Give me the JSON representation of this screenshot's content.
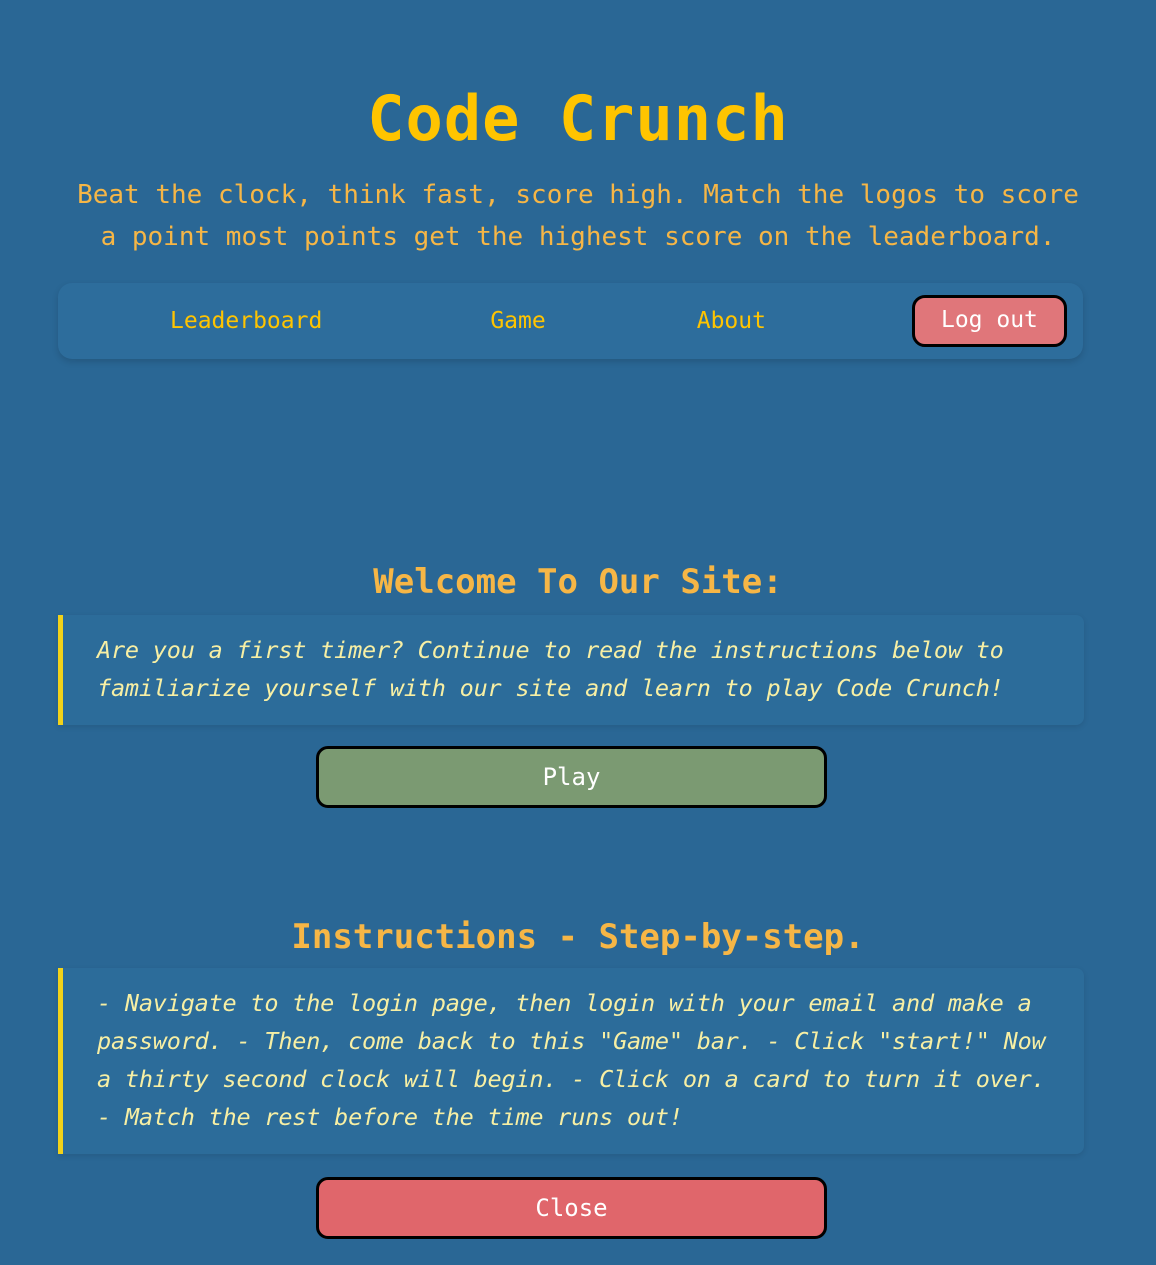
{
  "header": {
    "title": "Code Crunch",
    "tagline": "Beat the clock, think fast, score high. Match the logos to score a point most points get the highest score on the leaderboard."
  },
  "nav": {
    "links": [
      {
        "label": "Leaderboard"
      },
      {
        "label": "Game"
      },
      {
        "label": "About"
      }
    ],
    "logout_label": "Log out"
  },
  "welcome": {
    "heading": "Welcome To Our Site:",
    "quote": "Are you a first timer? Continue to read the instructions below to familiarize yourself with our site and learn to play Code Crunch!",
    "play_label": "Play"
  },
  "instructions": {
    "heading": "Instructions - Step-by-step.",
    "quote": "- Navigate to the login page, then login with your email and make a password. - Then, come back to this \"Game\" bar. - Click \"start!\" Now a thirty second clock will begin. - Click on a card to turn it over. - Match the rest before the time runs out!",
    "close_label": "Close"
  },
  "colors": {
    "page_background": "#2a6795",
    "title_gold": "#ffc400",
    "heading_amber": "#f6b646",
    "quote_cream": "#f7efa4",
    "quote_border": "#f2d21a",
    "play_green": "#7b9a72",
    "close_red": "#e0666b",
    "logout_red": "#e0767a",
    "navbar_background": "#2d6d9c"
  }
}
